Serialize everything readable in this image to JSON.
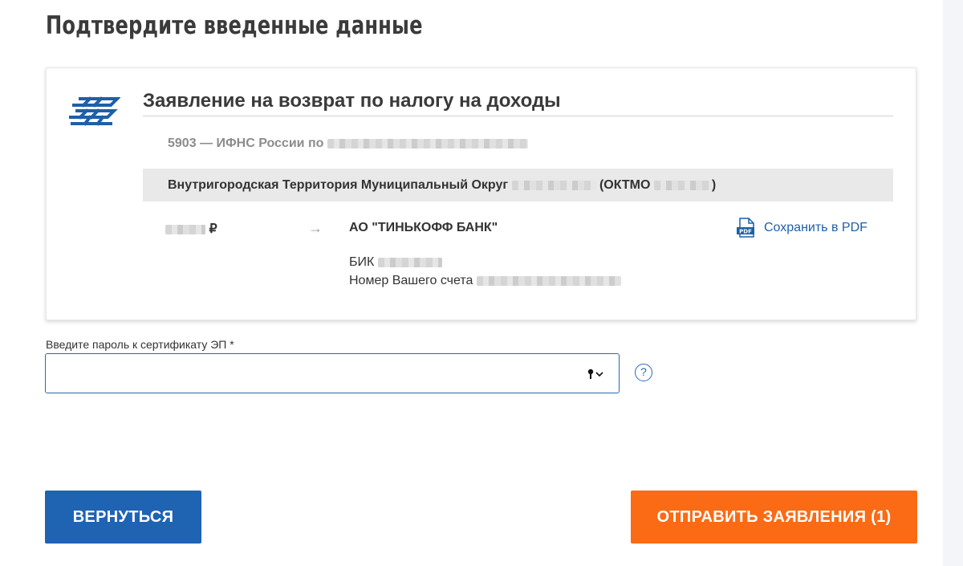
{
  "page": {
    "title": "Подтвердите введенные данные"
  },
  "application": {
    "title": "Заявление на возврат по налогу на доходы",
    "ifns": "5903 — ИФНС России по",
    "territory_prefix": "Внутригородская Территория Муниципальный Округ",
    "oktmo_label": "(ОКТМО",
    "oktmo_close": ")",
    "amount_currency": "₽",
    "arrow": "→",
    "bank_name": "АО \"ТИНЬКОФФ БАНК\"",
    "bik_label": "БИК",
    "account_label": "Номер Вашего счета",
    "pdf_label": "Сохранить в PDF"
  },
  "password": {
    "label": "Введите пароль к сертификату ЭП *",
    "value": "",
    "help": "?"
  },
  "buttons": {
    "back": "ВЕРНУТЬСЯ",
    "send": "ОТПРАВИТЬ ЗАЯВЛЕНИЯ (1)"
  },
  "colors": {
    "accent_blue": "#1f63b3",
    "send_orange": "#fb6a14",
    "link_blue": "#1f5fa8"
  }
}
